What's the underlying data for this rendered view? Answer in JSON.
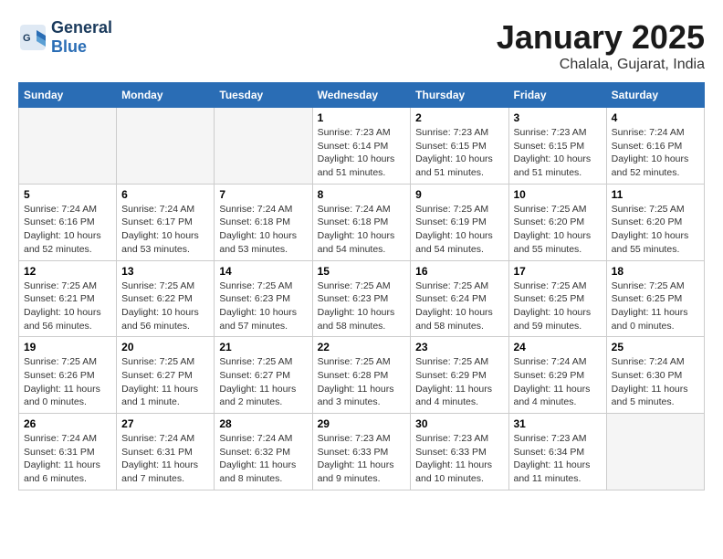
{
  "header": {
    "logo_line1": "General",
    "logo_line2": "Blue",
    "month": "January 2025",
    "location": "Chalala, Gujarat, India"
  },
  "days_of_week": [
    "Sunday",
    "Monday",
    "Tuesday",
    "Wednesday",
    "Thursday",
    "Friday",
    "Saturday"
  ],
  "weeks": [
    [
      {
        "day": "",
        "info": ""
      },
      {
        "day": "",
        "info": ""
      },
      {
        "day": "",
        "info": ""
      },
      {
        "day": "1",
        "info": "Sunrise: 7:23 AM\nSunset: 6:14 PM\nDaylight: 10 hours\nand 51 minutes."
      },
      {
        "day": "2",
        "info": "Sunrise: 7:23 AM\nSunset: 6:15 PM\nDaylight: 10 hours\nand 51 minutes."
      },
      {
        "day": "3",
        "info": "Sunrise: 7:23 AM\nSunset: 6:15 PM\nDaylight: 10 hours\nand 51 minutes."
      },
      {
        "day": "4",
        "info": "Sunrise: 7:24 AM\nSunset: 6:16 PM\nDaylight: 10 hours\nand 52 minutes."
      }
    ],
    [
      {
        "day": "5",
        "info": "Sunrise: 7:24 AM\nSunset: 6:16 PM\nDaylight: 10 hours\nand 52 minutes."
      },
      {
        "day": "6",
        "info": "Sunrise: 7:24 AM\nSunset: 6:17 PM\nDaylight: 10 hours\nand 53 minutes."
      },
      {
        "day": "7",
        "info": "Sunrise: 7:24 AM\nSunset: 6:18 PM\nDaylight: 10 hours\nand 53 minutes."
      },
      {
        "day": "8",
        "info": "Sunrise: 7:24 AM\nSunset: 6:18 PM\nDaylight: 10 hours\nand 54 minutes."
      },
      {
        "day": "9",
        "info": "Sunrise: 7:25 AM\nSunset: 6:19 PM\nDaylight: 10 hours\nand 54 minutes."
      },
      {
        "day": "10",
        "info": "Sunrise: 7:25 AM\nSunset: 6:20 PM\nDaylight: 10 hours\nand 55 minutes."
      },
      {
        "day": "11",
        "info": "Sunrise: 7:25 AM\nSunset: 6:20 PM\nDaylight: 10 hours\nand 55 minutes."
      }
    ],
    [
      {
        "day": "12",
        "info": "Sunrise: 7:25 AM\nSunset: 6:21 PM\nDaylight: 10 hours\nand 56 minutes."
      },
      {
        "day": "13",
        "info": "Sunrise: 7:25 AM\nSunset: 6:22 PM\nDaylight: 10 hours\nand 56 minutes."
      },
      {
        "day": "14",
        "info": "Sunrise: 7:25 AM\nSunset: 6:23 PM\nDaylight: 10 hours\nand 57 minutes."
      },
      {
        "day": "15",
        "info": "Sunrise: 7:25 AM\nSunset: 6:23 PM\nDaylight: 10 hours\nand 58 minutes."
      },
      {
        "day": "16",
        "info": "Sunrise: 7:25 AM\nSunset: 6:24 PM\nDaylight: 10 hours\nand 58 minutes."
      },
      {
        "day": "17",
        "info": "Sunrise: 7:25 AM\nSunset: 6:25 PM\nDaylight: 10 hours\nand 59 minutes."
      },
      {
        "day": "18",
        "info": "Sunrise: 7:25 AM\nSunset: 6:25 PM\nDaylight: 11 hours\nand 0 minutes."
      }
    ],
    [
      {
        "day": "19",
        "info": "Sunrise: 7:25 AM\nSunset: 6:26 PM\nDaylight: 11 hours\nand 0 minutes."
      },
      {
        "day": "20",
        "info": "Sunrise: 7:25 AM\nSunset: 6:27 PM\nDaylight: 11 hours\nand 1 minute."
      },
      {
        "day": "21",
        "info": "Sunrise: 7:25 AM\nSunset: 6:27 PM\nDaylight: 11 hours\nand 2 minutes."
      },
      {
        "day": "22",
        "info": "Sunrise: 7:25 AM\nSunset: 6:28 PM\nDaylight: 11 hours\nand 3 minutes."
      },
      {
        "day": "23",
        "info": "Sunrise: 7:25 AM\nSunset: 6:29 PM\nDaylight: 11 hours\nand 4 minutes."
      },
      {
        "day": "24",
        "info": "Sunrise: 7:24 AM\nSunset: 6:29 PM\nDaylight: 11 hours\nand 4 minutes."
      },
      {
        "day": "25",
        "info": "Sunrise: 7:24 AM\nSunset: 6:30 PM\nDaylight: 11 hours\nand 5 minutes."
      }
    ],
    [
      {
        "day": "26",
        "info": "Sunrise: 7:24 AM\nSunset: 6:31 PM\nDaylight: 11 hours\nand 6 minutes."
      },
      {
        "day": "27",
        "info": "Sunrise: 7:24 AM\nSunset: 6:31 PM\nDaylight: 11 hours\nand 7 minutes."
      },
      {
        "day": "28",
        "info": "Sunrise: 7:24 AM\nSunset: 6:32 PM\nDaylight: 11 hours\nand 8 minutes."
      },
      {
        "day": "29",
        "info": "Sunrise: 7:23 AM\nSunset: 6:33 PM\nDaylight: 11 hours\nand 9 minutes."
      },
      {
        "day": "30",
        "info": "Sunrise: 7:23 AM\nSunset: 6:33 PM\nDaylight: 11 hours\nand 10 minutes."
      },
      {
        "day": "31",
        "info": "Sunrise: 7:23 AM\nSunset: 6:34 PM\nDaylight: 11 hours\nand 11 minutes."
      },
      {
        "day": "",
        "info": ""
      }
    ]
  ]
}
